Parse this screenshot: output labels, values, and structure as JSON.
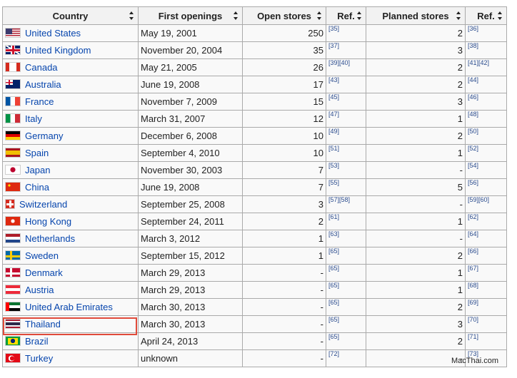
{
  "table": {
    "headers": [
      "Country",
      "First openings",
      "Open stores",
      "Ref.",
      "Planned stores",
      "Ref."
    ],
    "rows": [
      {
        "country": "United States",
        "flag": "us-flag",
        "first": "May 19, 2001",
        "open": "250",
        "ref1": "[35]",
        "planned": "2",
        "ref2": "[36]"
      },
      {
        "country": "United Kingdom",
        "flag": "uk-flag",
        "first": "November 20, 2004",
        "open": "35",
        "ref1": "[37]",
        "planned": "3",
        "ref2": "[38]"
      },
      {
        "country": "Canada",
        "flag": "canada-flag",
        "first": "May 21, 2005",
        "open": "26",
        "ref1": "[39][40]",
        "planned": "2",
        "ref2": "[41][42]"
      },
      {
        "country": "Australia",
        "flag": "australia-flag",
        "first": "June 19, 2008",
        "open": "17",
        "ref1": "[43]",
        "planned": "2",
        "ref2": "[44]"
      },
      {
        "country": "France",
        "flag": "france-flag",
        "first": "November 7, 2009",
        "open": "15",
        "ref1": "[45]",
        "planned": "3",
        "ref2": "[46]"
      },
      {
        "country": "Italy",
        "flag": "italy-flag",
        "first": "March 31, 2007",
        "open": "12",
        "ref1": "[47]",
        "planned": "1",
        "ref2": "[48]"
      },
      {
        "country": "Germany",
        "flag": "germany-flag",
        "first": "December 6, 2008",
        "open": "10",
        "ref1": "[49]",
        "planned": "2",
        "ref2": "[50]"
      },
      {
        "country": "Spain",
        "flag": "spain-flag",
        "first": "September 4, 2010",
        "open": "10",
        "ref1": "[51]",
        "planned": "1",
        "ref2": "[52]"
      },
      {
        "country": "Japan",
        "flag": "japan-flag",
        "first": "November 30, 2003",
        "open": "7",
        "ref1": "[53]",
        "planned": "-",
        "ref2": "[54]"
      },
      {
        "country": "China",
        "flag": "china-flag",
        "first": "June 19, 2008",
        "open": "7",
        "ref1": "[55]",
        "planned": "5",
        "ref2": "[56]"
      },
      {
        "country": "Switzerland",
        "flag": "switzerland-flag",
        "first": "September 25, 2008",
        "open": "3",
        "ref1": "[57][58]",
        "planned": "-",
        "ref2": "[59][60]"
      },
      {
        "country": "Hong Kong",
        "flag": "hong-kong-flag",
        "first": "September 24, 2011",
        "open": "2",
        "ref1": "[61]",
        "planned": "1",
        "ref2": "[62]"
      },
      {
        "country": "Netherlands",
        "flag": "netherlands-flag",
        "first": "March 3, 2012",
        "open": "1",
        "ref1": "[63]",
        "planned": "-",
        "ref2": "[64]"
      },
      {
        "country": "Sweden",
        "flag": "sweden-flag",
        "first": "September 15, 2012",
        "open": "1",
        "ref1": "[65]",
        "planned": "2",
        "ref2": "[66]"
      },
      {
        "country": "Denmark",
        "flag": "denmark-flag",
        "first": "March 29, 2013",
        "open": "-",
        "ref1": "[65]",
        "planned": "1",
        "ref2": "[67]"
      },
      {
        "country": "Austria",
        "flag": "austria-flag",
        "first": "March 29, 2013",
        "open": "-",
        "ref1": "[65]",
        "planned": "1",
        "ref2": "[68]"
      },
      {
        "country": "United Arab Emirates",
        "flag": "uae-flag",
        "first": "March 30, 2013",
        "open": "-",
        "ref1": "[65]",
        "planned": "2",
        "ref2": "[69]"
      },
      {
        "country": "Thailand",
        "flag": "thailand-flag",
        "first": "March 30, 2013",
        "open": "-",
        "ref1": "[65]",
        "planned": "3",
        "ref2": "[70]"
      },
      {
        "country": "Brazil",
        "flag": "brazil-flag",
        "first": "April 24, 2013",
        "open": "-",
        "ref1": "[65]",
        "planned": "2",
        "ref2": "[71]"
      },
      {
        "country": "Turkey",
        "flag": "turkey-flag",
        "first": "unknown",
        "open": "-",
        "ref1": "[72]",
        "planned": "-",
        "ref2": "[73]"
      }
    ]
  },
  "watermark": "MacThai.com",
  "colors": {
    "link": "#0645ad",
    "highlight": "#e04a3a",
    "header_bg": "#f2f2f2",
    "cell_bg": "#f9f9f9"
  }
}
